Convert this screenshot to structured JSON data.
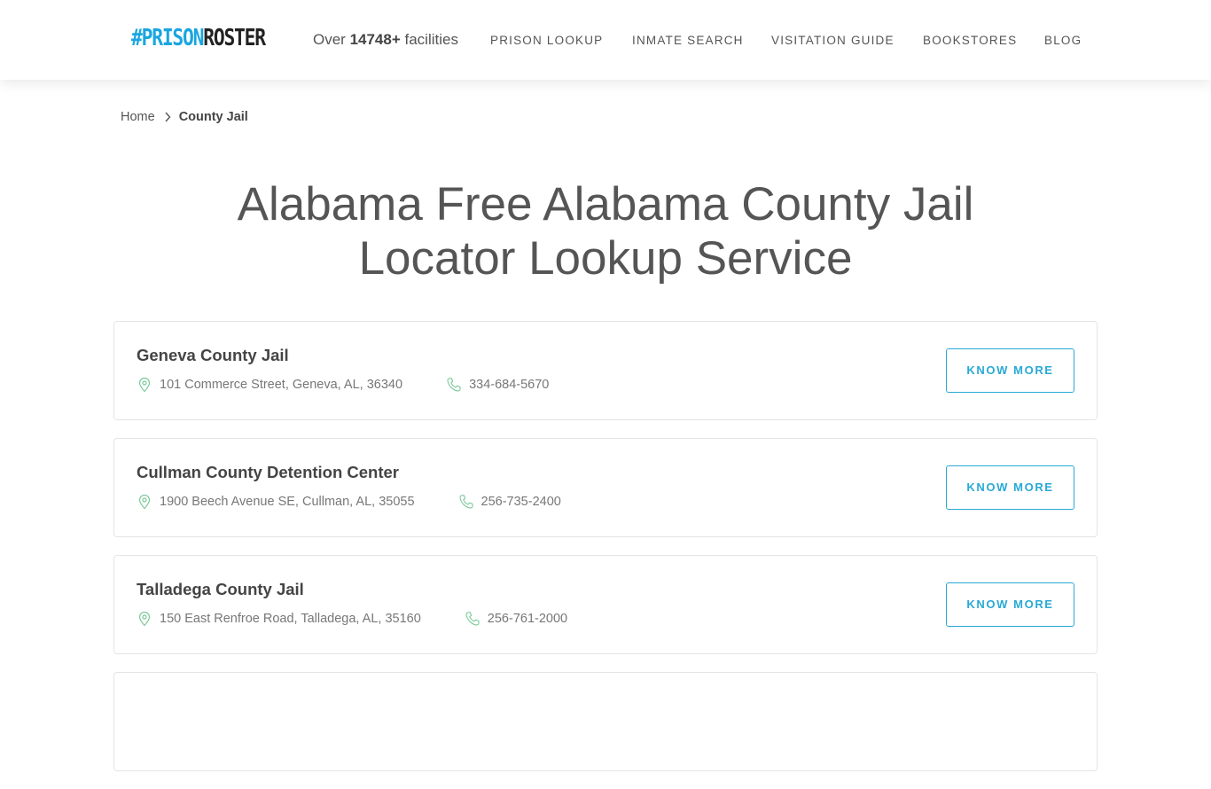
{
  "header": {
    "logo_prefix": "#PRISON",
    "logo_suffix": "ROSTER",
    "facility_count": {
      "prefix": "Over ",
      "number": "14748+",
      "suffix": " facilities"
    },
    "nav": [
      {
        "label": "PRISON LOOKUP"
      },
      {
        "label": "INMATE SEARCH"
      },
      {
        "label": "VISITATION GUIDE"
      },
      {
        "label": "BOOKSTORES"
      },
      {
        "label": "BLOG"
      }
    ]
  },
  "breadcrumb": {
    "home": "Home",
    "current": "County Jail"
  },
  "page_title": {
    "line1": "Alabama Free Alabama County Jail",
    "line2": "Locator Lookup Service"
  },
  "colors": {
    "brand": "#1aa6e0",
    "accent": "#29a9d6",
    "icon_green": "#7cc99a"
  },
  "facilities": [
    {
      "name": "Geneva County Jail",
      "address": "101 Commerce Street, Geneva, AL, 36340",
      "phone": "334-684-5670",
      "button": "KNOW MORE",
      "address_icon": "map-pin-icon",
      "phone_icon": "phone-icon"
    },
    {
      "name": "Cullman County Detention Center",
      "address": "1900 Beech Avenue SE, Cullman, AL, 35055",
      "phone": "256-735-2400",
      "button": "KNOW MORE",
      "address_icon": "map-pin-icon",
      "phone_icon": "phone-icon"
    },
    {
      "name": "Talladega County Jail",
      "address": "150 East Renfroe Road, Talladega, AL, 35160",
      "phone": "256-761-2000",
      "button": "KNOW MORE",
      "address_icon": "map-pin-icon",
      "phone_icon": "phone-icon"
    }
  ]
}
